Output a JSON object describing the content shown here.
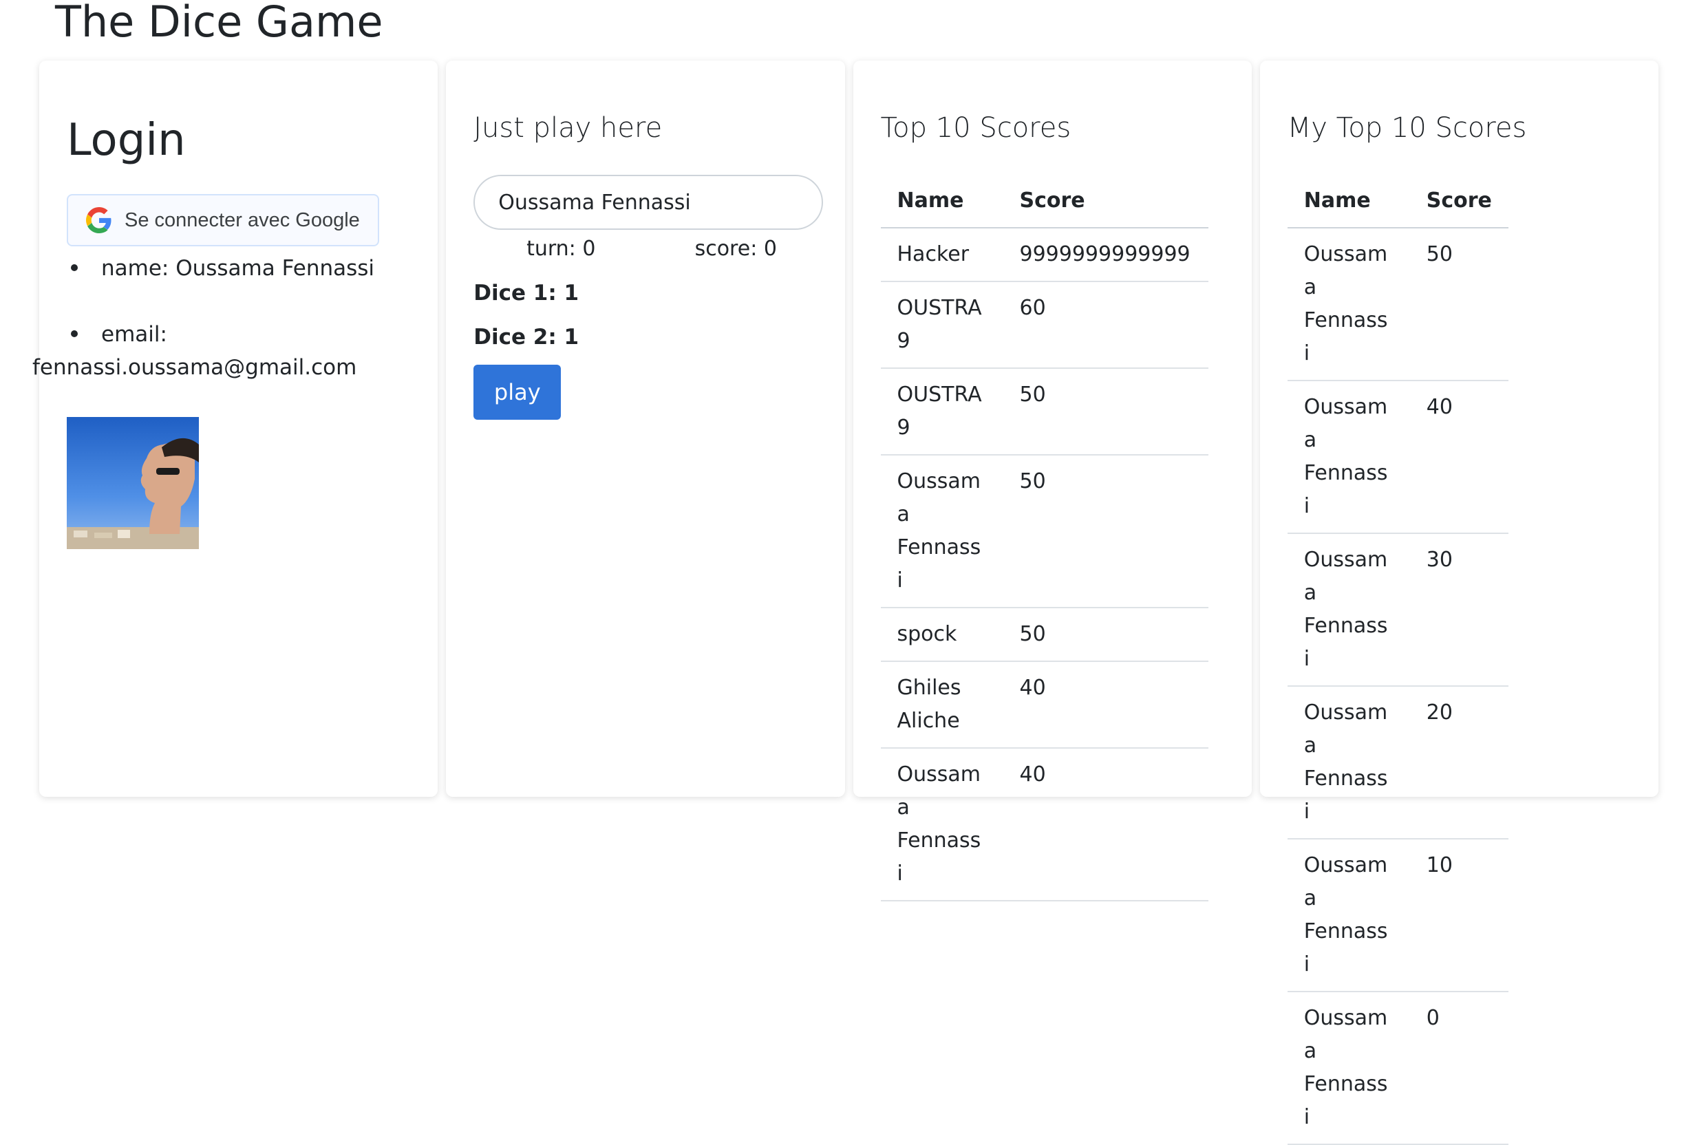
{
  "app": {
    "title": "The Dice Game"
  },
  "login": {
    "heading": "Login",
    "google_button_label": "Se connecter avec Google",
    "name_line": "name: Oussama Fennassi",
    "email_label": "email:",
    "email_value": "fennassi.oussama@gmail.com"
  },
  "play": {
    "heading": "Just play here",
    "name_input_value": "Oussama Fennassi",
    "turn_text": "turn: 0",
    "score_text": "score: 0",
    "dice1_text": "Dice 1: 1",
    "dice2_text": "Dice 2: 1",
    "play_button_label": "play"
  },
  "top_scores": {
    "heading": "Top 10 Scores",
    "columns": [
      "Name",
      "Score"
    ],
    "rows": [
      {
        "name": "Hacker",
        "score": "9999999999999"
      },
      {
        "name": "OUSTRA 9",
        "score": "60"
      },
      {
        "name": "OUSTRA 9",
        "score": "50"
      },
      {
        "name": "Oussama Fennassi",
        "score": "50"
      },
      {
        "name": "spock",
        "score": "50"
      },
      {
        "name": "Ghiles Aliche",
        "score": "40"
      },
      {
        "name": "Oussama Fennassi",
        "score": "40"
      }
    ]
  },
  "my_scores": {
    "heading": "My Top 10 Scores",
    "columns": [
      "Name",
      "Score"
    ],
    "rows": [
      {
        "name": "Oussama Fennassi",
        "score": "50"
      },
      {
        "name": "Oussama Fennassi",
        "score": "40"
      },
      {
        "name": "Oussama Fennassi",
        "score": "30"
      },
      {
        "name": "Oussama Fennassi",
        "score": "20"
      },
      {
        "name": "Oussama Fennassi",
        "score": "10"
      },
      {
        "name": "Oussama Fennassi",
        "score": "0"
      }
    ]
  },
  "icons": {
    "google": "google-g-icon",
    "avatar": "profile-photo"
  },
  "colors": {
    "primary_button": "#2f74d9",
    "google_border": "#d2e3fc"
  }
}
